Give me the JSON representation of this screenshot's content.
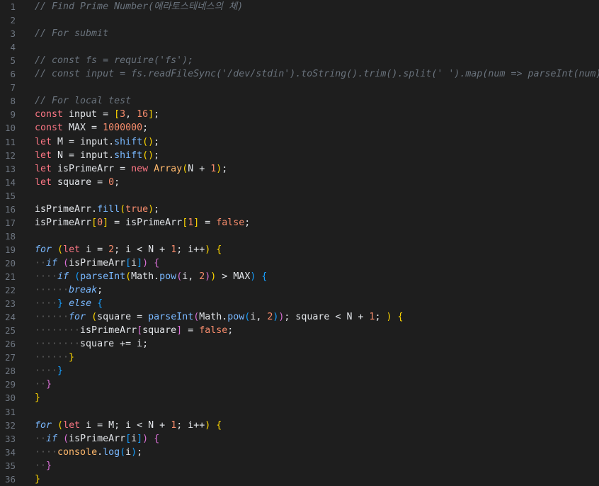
{
  "editor": {
    "lines": [
      {
        "n": "1",
        "tokens": [
          [
            "// Find Prime Number(에라토스테네스의 체)",
            "comment"
          ]
        ]
      },
      {
        "n": "2",
        "tokens": []
      },
      {
        "n": "3",
        "tokens": [
          [
            "// For submit",
            "comment"
          ]
        ]
      },
      {
        "n": "4",
        "tokens": []
      },
      {
        "n": "5",
        "tokens": [
          [
            "// const fs = require('fs');",
            "comment"
          ]
        ]
      },
      {
        "n": "6",
        "tokens": [
          [
            "// const input = fs.readFileSync('/dev/stdin').toString().trim().split(' ').map(num => parseInt(num));",
            "comment"
          ]
        ]
      },
      {
        "n": "7",
        "tokens": []
      },
      {
        "n": "8",
        "tokens": [
          [
            "// For local test",
            "comment"
          ]
        ]
      },
      {
        "n": "9",
        "tokens": [
          [
            "const",
            "kw"
          ],
          [
            " input = ",
            "plain"
          ],
          [
            "[",
            "br1"
          ],
          [
            "3",
            "num"
          ],
          [
            ", ",
            "plain"
          ],
          [
            "16",
            "num"
          ],
          [
            "]",
            "br1"
          ],
          [
            ";",
            "plain"
          ]
        ]
      },
      {
        "n": "10",
        "tokens": [
          [
            "const",
            "kw"
          ],
          [
            " MAX = ",
            "plain"
          ],
          [
            "1000000",
            "num"
          ],
          [
            ";",
            "plain"
          ]
        ]
      },
      {
        "n": "11",
        "tokens": [
          [
            "let",
            "kw"
          ],
          [
            " M = input.",
            "plain"
          ],
          [
            "shift",
            "fn"
          ],
          [
            "()",
            "br1"
          ],
          [
            ";",
            "plain"
          ]
        ]
      },
      {
        "n": "12",
        "tokens": [
          [
            "let",
            "kw"
          ],
          [
            " N = input.",
            "plain"
          ],
          [
            "shift",
            "fn"
          ],
          [
            "()",
            "br1"
          ],
          [
            ";",
            "plain"
          ]
        ]
      },
      {
        "n": "13",
        "tokens": [
          [
            "let",
            "kw"
          ],
          [
            " isPrimeArr = ",
            "plain"
          ],
          [
            "new",
            "kw"
          ],
          [
            " ",
            "plain"
          ],
          [
            "Array",
            "cls"
          ],
          [
            "(",
            "br1"
          ],
          [
            "N + ",
            "plain"
          ],
          [
            "1",
            "num"
          ],
          [
            ")",
            "br1"
          ],
          [
            ";",
            "plain"
          ]
        ]
      },
      {
        "n": "14",
        "tokens": [
          [
            "let",
            "kw"
          ],
          [
            " square = ",
            "plain"
          ],
          [
            "0",
            "num"
          ],
          [
            ";",
            "plain"
          ]
        ]
      },
      {
        "n": "15",
        "tokens": []
      },
      {
        "n": "16",
        "tokens": [
          [
            "isPrimeArr.",
            "plain"
          ],
          [
            "fill",
            "fn"
          ],
          [
            "(",
            "br1"
          ],
          [
            "true",
            "bool"
          ],
          [
            ")",
            "br1"
          ],
          [
            ";",
            "plain"
          ]
        ]
      },
      {
        "n": "17",
        "tokens": [
          [
            "isPrimeArr",
            "plain"
          ],
          [
            "[",
            "br1"
          ],
          [
            "0",
            "num"
          ],
          [
            "]",
            "br1"
          ],
          [
            " = isPrimeArr",
            "plain"
          ],
          [
            "[",
            "br1"
          ],
          [
            "1",
            "num"
          ],
          [
            "]",
            "br1"
          ],
          [
            " = ",
            "plain"
          ],
          [
            "false",
            "bool"
          ],
          [
            ";",
            "plain"
          ]
        ]
      },
      {
        "n": "18",
        "tokens": []
      },
      {
        "n": "19",
        "tokens": [
          [
            "for",
            "ctl"
          ],
          [
            " ",
            "plain"
          ],
          [
            "(",
            "br1"
          ],
          [
            "let",
            "kw"
          ],
          [
            " i = ",
            "plain"
          ],
          [
            "2",
            "num"
          ],
          [
            "; i < N + ",
            "plain"
          ],
          [
            "1",
            "num"
          ],
          [
            "; i++",
            "plain"
          ],
          [
            ")",
            "br1"
          ],
          [
            " ",
            "plain"
          ],
          [
            "{",
            "br1"
          ]
        ]
      },
      {
        "n": "20",
        "tokens": [
          [
            "··",
            "ind"
          ],
          [
            "if",
            "ctl"
          ],
          [
            " ",
            "plain"
          ],
          [
            "(",
            "br2"
          ],
          [
            "isPrimeArr",
            "plain"
          ],
          [
            "[",
            "br3"
          ],
          [
            "i",
            "plain"
          ],
          [
            "]",
            "br3"
          ],
          [
            ")",
            "br2"
          ],
          [
            " ",
            "plain"
          ],
          [
            "{",
            "br2"
          ]
        ]
      },
      {
        "n": "21",
        "tokens": [
          [
            "····",
            "ind"
          ],
          [
            "if",
            "ctl"
          ],
          [
            " ",
            "plain"
          ],
          [
            "(",
            "br3"
          ],
          [
            "parseInt",
            "fn"
          ],
          [
            "(",
            "br1"
          ],
          [
            "Math.",
            "plain"
          ],
          [
            "pow",
            "fn"
          ],
          [
            "(",
            "br2"
          ],
          [
            "i, ",
            "plain"
          ],
          [
            "2",
            "num"
          ],
          [
            ")",
            "br2"
          ],
          [
            ")",
            "br1"
          ],
          [
            " > MAX",
            "plain"
          ],
          [
            ")",
            "br3"
          ],
          [
            " ",
            "plain"
          ],
          [
            "{",
            "br3"
          ]
        ]
      },
      {
        "n": "22",
        "tokens": [
          [
            "······",
            "ind"
          ],
          [
            "break",
            "ctl"
          ],
          [
            ";",
            "plain"
          ]
        ]
      },
      {
        "n": "23",
        "tokens": [
          [
            "····",
            "ind"
          ],
          [
            "}",
            "br3"
          ],
          [
            " ",
            "plain"
          ],
          [
            "else",
            "ctl"
          ],
          [
            " ",
            "plain"
          ],
          [
            "{",
            "br3"
          ]
        ]
      },
      {
        "n": "24",
        "tokens": [
          [
            "······",
            "ind"
          ],
          [
            "for",
            "ctl"
          ],
          [
            " ",
            "plain"
          ],
          [
            "(",
            "br1"
          ],
          [
            "square = ",
            "plain"
          ],
          [
            "parseInt",
            "fn"
          ],
          [
            "(",
            "br2"
          ],
          [
            "Math.",
            "plain"
          ],
          [
            "pow",
            "fn"
          ],
          [
            "(",
            "br3"
          ],
          [
            "i, ",
            "plain"
          ],
          [
            "2",
            "num"
          ],
          [
            ")",
            "br3"
          ],
          [
            ")",
            "br2"
          ],
          [
            "; square < N + ",
            "plain"
          ],
          [
            "1",
            "num"
          ],
          [
            "; ",
            "plain"
          ],
          [
            ")",
            "br1"
          ],
          [
            " ",
            "plain"
          ],
          [
            "{",
            "br1"
          ]
        ]
      },
      {
        "n": "25",
        "tokens": [
          [
            "········",
            "ind"
          ],
          [
            "isPrimeArr",
            "plain"
          ],
          [
            "[",
            "br2"
          ],
          [
            "square",
            "plain"
          ],
          [
            "]",
            "br2"
          ],
          [
            " = ",
            "plain"
          ],
          [
            "false",
            "bool"
          ],
          [
            ";",
            "plain"
          ]
        ]
      },
      {
        "n": "26",
        "tokens": [
          [
            "········",
            "ind"
          ],
          [
            "square += i;",
            "plain"
          ]
        ]
      },
      {
        "n": "27",
        "tokens": [
          [
            "······",
            "ind"
          ],
          [
            "}",
            "br1"
          ]
        ]
      },
      {
        "n": "28",
        "tokens": [
          [
            "····",
            "ind"
          ],
          [
            "}",
            "br3"
          ]
        ]
      },
      {
        "n": "29",
        "tokens": [
          [
            "··",
            "ind"
          ],
          [
            "}",
            "br2"
          ]
        ]
      },
      {
        "n": "30",
        "tokens": [
          [
            "}",
            "br1"
          ]
        ]
      },
      {
        "n": "31",
        "tokens": []
      },
      {
        "n": "32",
        "tokens": [
          [
            "for",
            "ctl"
          ],
          [
            " ",
            "plain"
          ],
          [
            "(",
            "br1"
          ],
          [
            "let",
            "kw"
          ],
          [
            " i = M; i < N + ",
            "plain"
          ],
          [
            "1",
            "num"
          ],
          [
            "; i++",
            "plain"
          ],
          [
            ")",
            "br1"
          ],
          [
            " ",
            "plain"
          ],
          [
            "{",
            "br1"
          ]
        ]
      },
      {
        "n": "33",
        "tokens": [
          [
            "··",
            "ind"
          ],
          [
            "if",
            "ctl"
          ],
          [
            " ",
            "plain"
          ],
          [
            "(",
            "br2"
          ],
          [
            "isPrimeArr",
            "plain"
          ],
          [
            "[",
            "br3"
          ],
          [
            "i",
            "plain"
          ],
          [
            "]",
            "br3"
          ],
          [
            ")",
            "br2"
          ],
          [
            " ",
            "plain"
          ],
          [
            "{",
            "br2"
          ]
        ]
      },
      {
        "n": "34",
        "tokens": [
          [
            "····",
            "ind"
          ],
          [
            "console",
            "cls"
          ],
          [
            ".",
            "plain"
          ],
          [
            "log",
            "fn"
          ],
          [
            "(",
            "br3"
          ],
          [
            "i",
            "plain"
          ],
          [
            ")",
            "br3"
          ],
          [
            ";",
            "plain"
          ]
        ]
      },
      {
        "n": "35",
        "tokens": [
          [
            "··",
            "ind"
          ],
          [
            "}",
            "br2"
          ]
        ]
      },
      {
        "n": "36",
        "tokens": [
          [
            "}",
            "br1"
          ]
        ]
      }
    ]
  }
}
